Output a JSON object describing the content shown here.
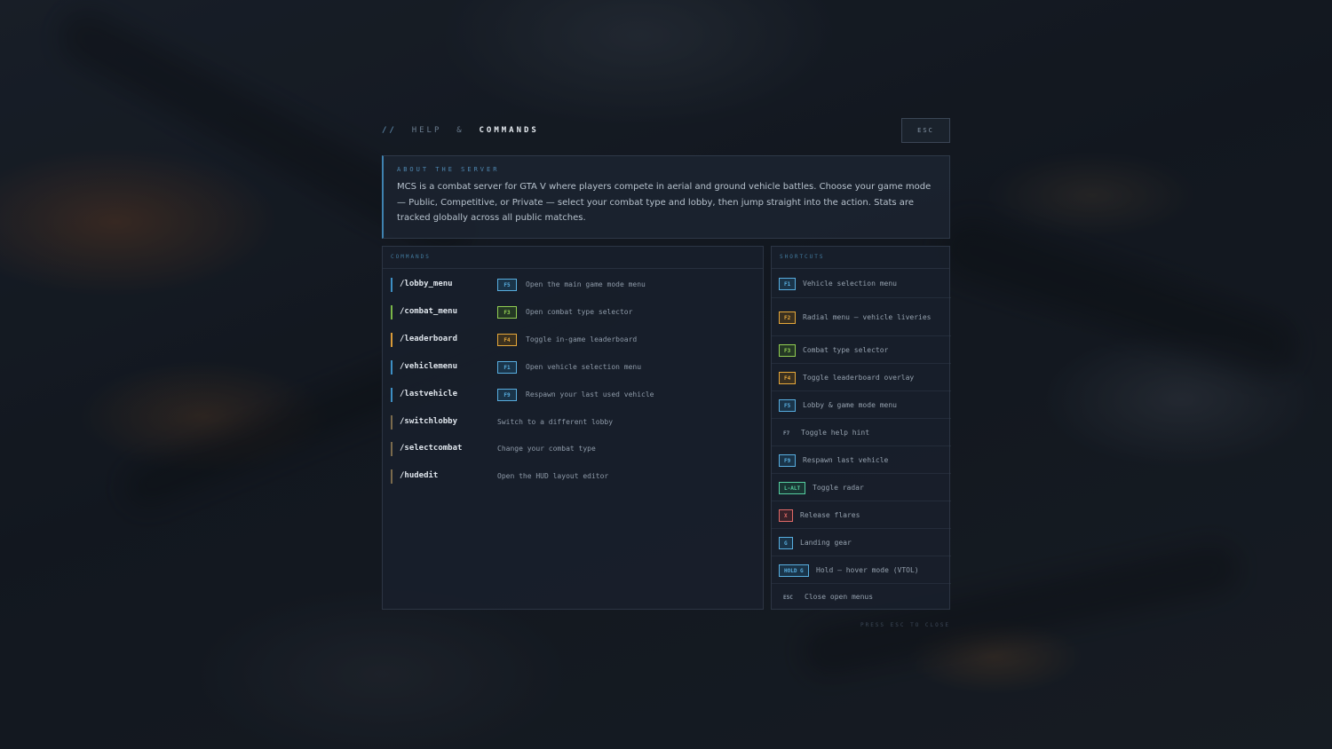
{
  "header": {
    "slash": "//",
    "title_dim": "HELP",
    "amp": "&",
    "title_strong": "COMMANDS",
    "esc_label": "ESC"
  },
  "about": {
    "label": "ABOUT THE SERVER",
    "text": "MCS is a combat server for GTA V where players compete in aerial and ground vehicle battles. Choose your game mode — Public, Competitive, or Private — select your combat type and lobby, then jump straight into the action. Stats are tracked globally across all public matches."
  },
  "commands": {
    "label": "COMMANDS",
    "items": [
      {
        "name": "/lobby_menu",
        "key": "F5",
        "key_color": "blue",
        "accent": "#3d8fc4",
        "desc": "Open the main game mode menu"
      },
      {
        "name": "/combat_menu",
        "key": "F3",
        "key_color": "green",
        "accent": "#7ab648",
        "desc": "Open combat type selector"
      },
      {
        "name": "/leaderboard",
        "key": "F4",
        "key_color": "amber",
        "accent": "#d99a38",
        "desc": "Toggle in-game leaderboard"
      },
      {
        "name": "/vehiclemenu",
        "key": "F1",
        "key_color": "blue",
        "accent": "#3d8fc4",
        "desc": "Open vehicle selection menu"
      },
      {
        "name": "/lastvehicle",
        "key": "F9",
        "key_color": "blue",
        "accent": "#3d8fc4",
        "desc": "Respawn your last used vehicle"
      },
      {
        "name": "/switchlobby",
        "key": "",
        "key_color": "",
        "accent": "#7a6a4c",
        "desc": "Switch to a different lobby"
      },
      {
        "name": "/selectcombat",
        "key": "",
        "key_color": "",
        "accent": "#7a6a4c",
        "desc": "Change your combat type"
      },
      {
        "name": "/hudedit",
        "key": "",
        "key_color": "",
        "accent": "#7a6a4c",
        "desc": "Open the HUD layout editor"
      }
    ]
  },
  "shortcuts": {
    "label": "SHORTCUTS",
    "items": [
      {
        "key": "F1",
        "key_color": "blue",
        "desc": "Vehicle selection menu"
      },
      {
        "key": "F2",
        "key_color": "amber",
        "desc": "Radial menu — vehicle liveries"
      },
      {
        "key": "F3",
        "key_color": "green",
        "desc": "Combat type selector"
      },
      {
        "key": "F4",
        "key_color": "amber",
        "desc": "Toggle leaderboard overlay"
      },
      {
        "key": "F5",
        "key_color": "blue",
        "desc": "Lobby & game mode menu"
      },
      {
        "key": "F7",
        "key_color": "plain",
        "desc": "Toggle help hint"
      },
      {
        "key": "F9",
        "key_color": "blue",
        "desc": "Respawn last vehicle"
      },
      {
        "key": "L-ALT",
        "key_color": "teal",
        "desc": "Toggle radar"
      },
      {
        "key": "X",
        "key_color": "red",
        "desc": "Release flares"
      },
      {
        "key": "G",
        "key_color": "blue",
        "desc": "Landing gear"
      },
      {
        "key": "HOLD G",
        "key_color": "blue",
        "desc": "Hold — hover mode (VTOL)"
      },
      {
        "key": "ESC",
        "key_color": "plain",
        "desc": "Close open menus"
      }
    ]
  },
  "footer": {
    "hint": "PRESS ESC TO CLOSE"
  }
}
